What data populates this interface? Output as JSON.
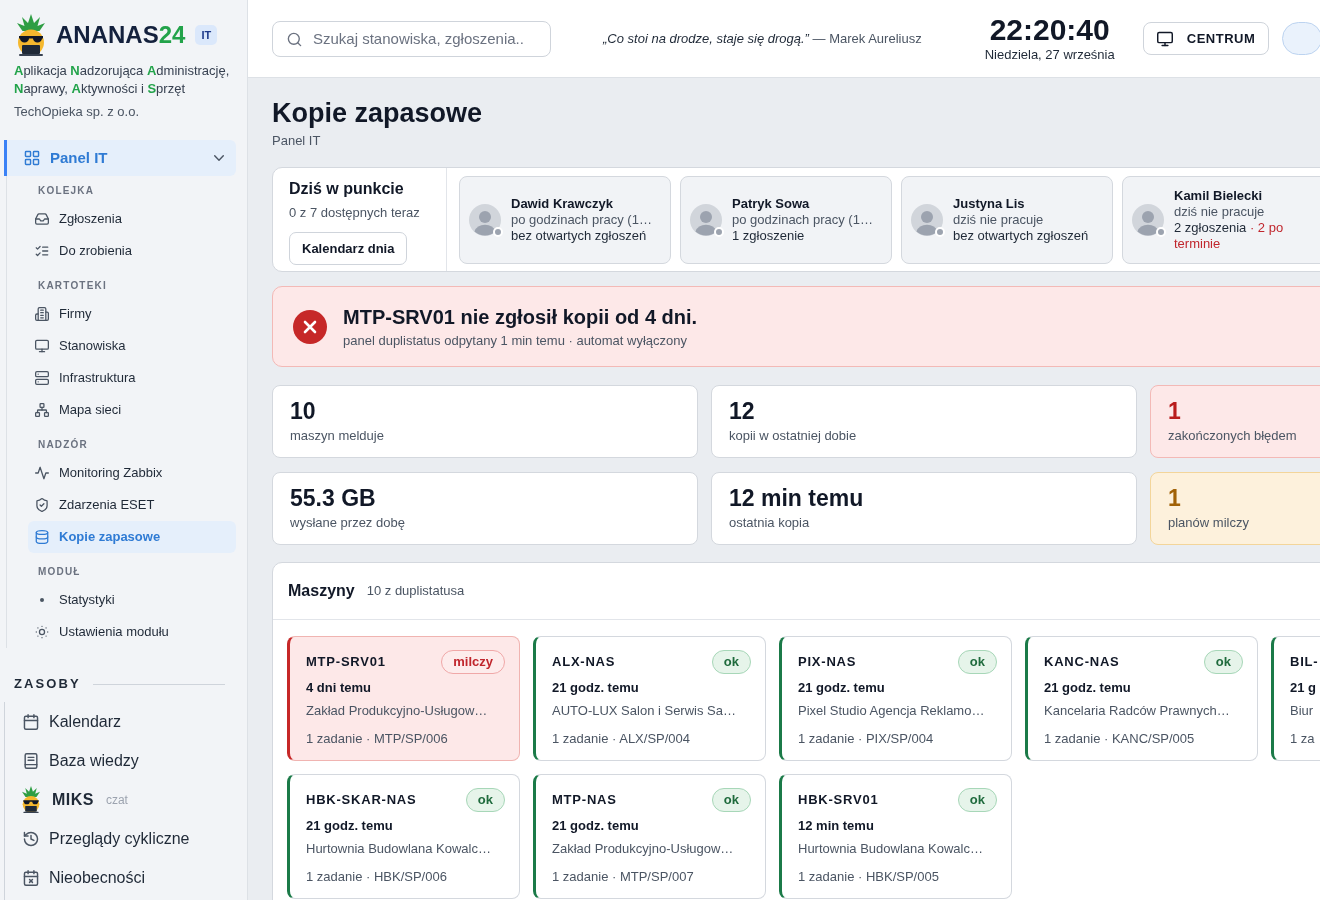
{
  "sidebar": {
    "brand": {
      "name": "ANANAS",
      "accent": "24",
      "badge": "IT"
    },
    "tagline": "**A**plikacja **N**adzorująca **A**dministrację, **N**aprawy, **A**ktywności i **S**przęt",
    "company": "TechOpieka sp. z o.o.",
    "nav": {
      "label": "Panel IT",
      "selected": true,
      "expanded": true,
      "sections": [
        {
          "heading": "KOLEJKA",
          "items": [
            {
              "label": "Zgłoszenia",
              "selected": false
            },
            {
              "label": "Do zrobienia",
              "selected": false
            }
          ]
        },
        {
          "heading": "KARTOTEKI",
          "items": [
            {
              "label": "Firmy",
              "selected": false
            },
            {
              "label": "Stanowiska",
              "selected": false
            },
            {
              "label": "Infrastruktura",
              "selected": false
            },
            {
              "label": "Mapa sieci",
              "selected": false
            }
          ]
        },
        {
          "heading": "NADZÓR",
          "items": [
            {
              "label": "Monitoring Zabbix",
              "selected": false
            },
            {
              "label": "Zdarzenia ESET",
              "selected": false
            },
            {
              "label": "Kopie zapasowe",
              "selected": true
            }
          ]
        },
        {
          "heading": "MODUŁ",
          "items": [
            {
              "label": "Statystyki",
              "selected": false
            },
            {
              "label": "Ustawienia modułu",
              "selected": false
            }
          ]
        }
      ]
    },
    "resources": {
      "heading": "ZASOBY",
      "items": [
        {
          "kind": "link",
          "label": "Kalendarz",
          "selected": false
        },
        {
          "kind": "link",
          "label": "Baza wiedzy",
          "selected": false
        },
        {
          "kind": "chat",
          "label": "MIKS",
          "note": "czat",
          "selected": false
        },
        {
          "kind": "link",
          "label": "Przeglądy cykliczne",
          "selected": false
        },
        {
          "kind": "link",
          "label": "Nieobecności",
          "selected": false
        }
      ]
    }
  },
  "header": {
    "search": {
      "placeholder": "Szukaj stanowiska, zgłoszenia.."
    },
    "quote": "*„Co stoi na drodze, staje się drogą.”* — Marek Aureliusz",
    "clock": {
      "time": "22:20:40",
      "date": "Niedziela, 27 września"
    },
    "center_button": "CENTRUM"
  },
  "page": {
    "title": "Kopie zapasowe",
    "breadcrumb": "Panel IT"
  },
  "today": {
    "title": "Dziś w punkcie",
    "summary": "0 z 7 dostępnych teraz",
    "button": "Kalendarz dnia",
    "people": [
      {
        "name": "Dawid Krawczyk",
        "status": "po godzinach pracy (1…",
        "tickets": "bez otwartych zgłoszeń",
        "available": false
      },
      {
        "name": "Patryk Sowa",
        "status": "po godzinach pracy (1…",
        "tickets": "1 zgłoszenie",
        "available": false
      },
      {
        "name": "Justyna Lis",
        "status": "dziś nie pracuje",
        "tickets": "bez otwartych zgłoszeń",
        "available": false
      },
      {
        "name": "Kamil Bielecki",
        "status": "dziś nie pracuje",
        "tickets": "2 zgłoszenia",
        "overdue": "· 2 po terminie",
        "available": false
      }
    ]
  },
  "alert": {
    "title": "MTP-SRV01 nie zgłosił kopii od 4 dni.",
    "detail": "panel duplistatus odpytany 1 min temu · automat wyłączony"
  },
  "stats": [
    {
      "kind": "plain",
      "value": "10",
      "label": "maszyn melduje"
    },
    {
      "kind": "plain",
      "value": "12",
      "label": "kopii w ostatniej dobie"
    },
    {
      "kind": "error",
      "value": "1",
      "label": "zakończonych błędem"
    },
    {
      "kind": "plain",
      "value": "55.3 GB",
      "label": "wysłane przez dobę"
    },
    {
      "kind": "plain",
      "value": "12 min temu",
      "label": "ostatnia kopia"
    },
    {
      "kind": "warning",
      "value": "1",
      "label": "planów milczy"
    }
  ],
  "machines": {
    "title": "Maszyny",
    "count": "10 z duplistatusa",
    "items": [
      {
        "name": "MTP-SRV01",
        "silent": true,
        "badge": "milczy",
        "last_backup": "4 dni temu",
        "company": "Zakład Produkcyjno-Usługow…",
        "footer": "1 zadanie · MTP/SP/006"
      },
      {
        "name": "ALX-NAS",
        "silent": false,
        "badge": "ok",
        "last_backup": "21 godz. temu",
        "company": "AUTO-LUX Salon i Serwis Sa…",
        "footer": "1 zadanie · ALX/SP/004"
      },
      {
        "name": "PIX-NAS",
        "silent": false,
        "badge": "ok",
        "last_backup": "21 godz. temu",
        "company": "Pixel Studio Agencja Reklamo…",
        "footer": "1 zadanie · PIX/SP/004"
      },
      {
        "name": "KANC-NAS",
        "silent": false,
        "badge": "ok",
        "last_backup": "21 godz. temu",
        "company": "Kancelaria Radców Prawnych…",
        "footer": "1 zadanie · KANC/SP/005"
      },
      {
        "name": "BIL-",
        "silent": false,
        "last_backup": "21 g",
        "company": "Biur",
        "footer": "1 za"
      },
      {
        "name": "HBK-SKAR-NAS",
        "silent": false,
        "badge": "ok",
        "last_backup": "21 godz. temu",
        "company": "Hurtownia Budowlana Kowalc…",
        "footer": "1 zadanie · HBK/SP/006"
      },
      {
        "name": "MTP-NAS",
        "silent": false,
        "badge": "ok",
        "last_backup": "21 godz. temu",
        "company": "Zakład Produkcyjno-Usługow…",
        "footer": "1 zadanie · MTP/SP/007"
      },
      {
        "name": "HBK-SRV01",
        "silent": false,
        "badge": "ok",
        "last_backup": "12 min temu",
        "company": "Hurtownia Budowlana Kowalc…",
        "footer": "1 zadanie · HBK/SP/005"
      }
    ]
  }
}
